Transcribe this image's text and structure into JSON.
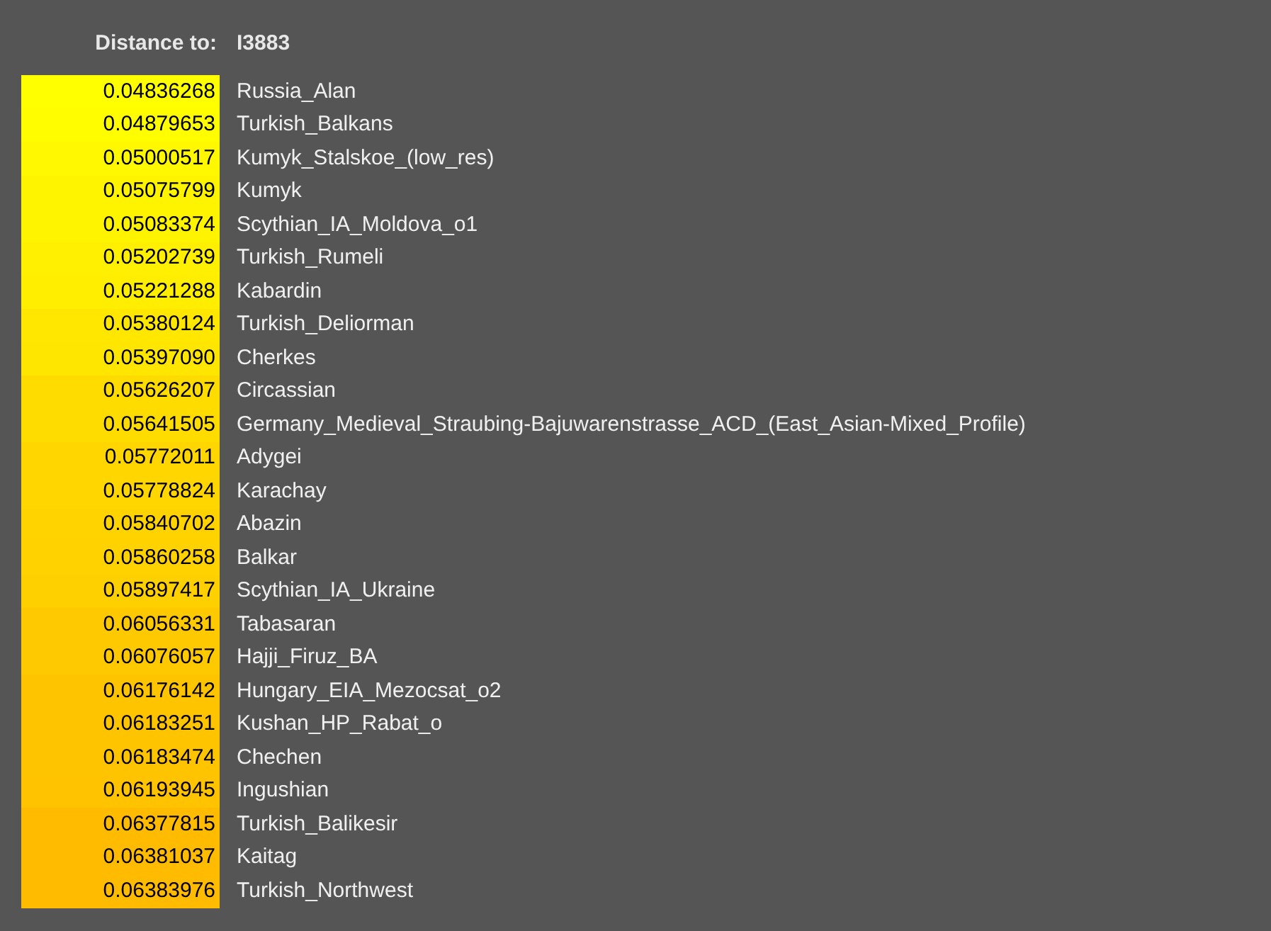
{
  "header": {
    "label": "Distance to:",
    "target": "I3883"
  },
  "rows": [
    {
      "distance": "0.04836268",
      "name": "Russia_Alan",
      "color": "#ffff00"
    },
    {
      "distance": "0.04879653",
      "name": "Turkish_Balkans",
      "color": "#fffd00"
    },
    {
      "distance": "0.05000517",
      "name": "Kumyk_Stalskoe_(low_res)",
      "color": "#fff800"
    },
    {
      "distance": "0.05075799",
      "name": "Kumyk",
      "color": "#fff400"
    },
    {
      "distance": "0.05083374",
      "name": "Scythian_IA_Moldova_o1",
      "color": "#fff400"
    },
    {
      "distance": "0.05202739",
      "name": "Turkish_Rumeli",
      "color": "#ffef00"
    },
    {
      "distance": "0.05221288",
      "name": "Kabardin",
      "color": "#ffee00"
    },
    {
      "distance": "0.05380124",
      "name": "Turkish_Deliorman",
      "color": "#ffe700"
    },
    {
      "distance": "0.05397090",
      "name": "Cherkes",
      "color": "#ffe600"
    },
    {
      "distance": "0.05626207",
      "name": "Circassian",
      "color": "#ffdc00"
    },
    {
      "distance": "0.05641505",
      "name": "Germany_Medieval_Straubing-Bajuwarenstrasse_ACD_(East_Asian-Mixed_Profile)",
      "color": "#ffdc00"
    },
    {
      "distance": "0.05772011",
      "name": "Adygei",
      "color": "#ffd600"
    },
    {
      "distance": "0.05778824",
      "name": "Karachay",
      "color": "#ffd600"
    },
    {
      "distance": "0.05840702",
      "name": "Abazin",
      "color": "#ffd300"
    },
    {
      "distance": "0.05860258",
      "name": "Balkar",
      "color": "#ffd200"
    },
    {
      "distance": "0.05897417",
      "name": "Scythian_IA_Ukraine",
      "color": "#ffd000"
    },
    {
      "distance": "0.06056331",
      "name": "Tabasaran",
      "color": "#ffc900"
    },
    {
      "distance": "0.06076057",
      "name": "Hajji_Firuz_BA",
      "color": "#ffc900"
    },
    {
      "distance": "0.06176142",
      "name": "Hungary_EIA_Mezocsat_o2",
      "color": "#ffc400"
    },
    {
      "distance": "0.06183251",
      "name": "Kushan_HP_Rabat_o",
      "color": "#ffc400"
    },
    {
      "distance": "0.06183474",
      "name": "Chechen",
      "color": "#ffc400"
    },
    {
      "distance": "0.06193945",
      "name": "Ingushian",
      "color": "#ffc300"
    },
    {
      "distance": "0.06377815",
      "name": "Turkish_Balikesir",
      "color": "#ffbb00"
    },
    {
      "distance": "0.06381037",
      "name": "Kaitag",
      "color": "#ffbb00"
    },
    {
      "distance": "0.06383976",
      "name": "Turkish_Northwest",
      "color": "#ffbb00"
    }
  ]
}
